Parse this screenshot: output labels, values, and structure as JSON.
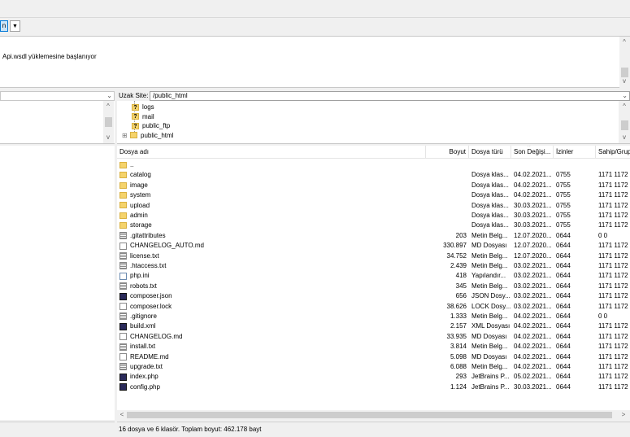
{
  "quickconnect": {
    "button_label": "n",
    "dropdown_icon": "chevron-down-icon"
  },
  "log": {
    "line": "Api.wsdl yüklemesine başlanıyor"
  },
  "remote": {
    "site_label": "Uzak Site:",
    "site_path": "/public_html",
    "tree": [
      {
        "label": "logs",
        "type": "unknown"
      },
      {
        "label": "mail",
        "type": "unknown"
      },
      {
        "label": "public_ftp",
        "type": "unknown"
      },
      {
        "label": "public_html",
        "type": "folder",
        "expand_symbol": "⊞"
      }
    ],
    "columns": {
      "name": "Dosya adı",
      "size": "Boyut",
      "type": "Dosya türü",
      "modified": "Son Değişi...",
      "perms": "İzinler",
      "owner": "Sahip/Grup"
    },
    "files": [
      {
        "icon": "folder",
        "name": "..",
        "size": "",
        "type": "",
        "modified": "",
        "perms": "",
        "owner": ""
      },
      {
        "icon": "folder",
        "name": "catalog",
        "size": "",
        "type": "Dosya klas...",
        "modified": "04.02.2021...",
        "perms": "0755",
        "owner": "1171 1172"
      },
      {
        "icon": "folder",
        "name": "image",
        "size": "",
        "type": "Dosya klas...",
        "modified": "04.02.2021...",
        "perms": "0755",
        "owner": "1171 1172"
      },
      {
        "icon": "folder",
        "name": "system",
        "size": "",
        "type": "Dosya klas...",
        "modified": "04.02.2021...",
        "perms": "0755",
        "owner": "1171 1172"
      },
      {
        "icon": "folder",
        "name": "upload",
        "size": "",
        "type": "Dosya klas...",
        "modified": "30.03.2021...",
        "perms": "0755",
        "owner": "1171 1172"
      },
      {
        "icon": "folder",
        "name": "admin",
        "size": "",
        "type": "Dosya klas...",
        "modified": "30.03.2021...",
        "perms": "0755",
        "owner": "1171 1172"
      },
      {
        "icon": "folder",
        "name": "storage",
        "size": "",
        "type": "Dosya klas...",
        "modified": "30.03.2021...",
        "perms": "0755",
        "owner": "1171 1172"
      },
      {
        "icon": "txt",
        "name": ".gitattributes",
        "size": "203",
        "type": "Metin Belg...",
        "modified": "12.07.2020...",
        "perms": "0644",
        "owner": "0 0"
      },
      {
        "icon": "file",
        "name": "CHANGELOG_AUTO.md",
        "size": "330.897",
        "type": "MD Dosyası",
        "modified": "12.07.2020...",
        "perms": "0644",
        "owner": "1171 1172"
      },
      {
        "icon": "txt",
        "name": "license.txt",
        "size": "34.752",
        "type": "Metin Belg...",
        "modified": "12.07.2020...",
        "perms": "0644",
        "owner": "1171 1172"
      },
      {
        "icon": "txt",
        "name": ".htaccess.txt",
        "size": "2.439",
        "type": "Metin Belg...",
        "modified": "03.02.2021...",
        "perms": "0644",
        "owner": "1171 1172"
      },
      {
        "icon": "ini",
        "name": "php.ini",
        "size": "418",
        "type": "Yapılandır...",
        "modified": "03.02.2021...",
        "perms": "0644",
        "owner": "1171 1172"
      },
      {
        "icon": "txt",
        "name": "robots.txt",
        "size": "345",
        "type": "Metin Belg...",
        "modified": "03.02.2021...",
        "perms": "0644",
        "owner": "1171 1172"
      },
      {
        "icon": "app",
        "name": "composer.json",
        "size": "656",
        "type": "JSON Dosy...",
        "modified": "03.02.2021...",
        "perms": "0644",
        "owner": "1171 1172"
      },
      {
        "icon": "file",
        "name": "composer.lock",
        "size": "38.626",
        "type": "LOCK Dosy...",
        "modified": "03.02.2021...",
        "perms": "0644",
        "owner": "1171 1172"
      },
      {
        "icon": "txt",
        "name": ".gitignore",
        "size": "1.333",
        "type": "Metin Belg...",
        "modified": "04.02.2021...",
        "perms": "0644",
        "owner": "0 0"
      },
      {
        "icon": "app",
        "name": "build.xml",
        "size": "2.157",
        "type": "XML Dosyası",
        "modified": "04.02.2021...",
        "perms": "0644",
        "owner": "1171 1172"
      },
      {
        "icon": "file",
        "name": "CHANGELOG.md",
        "size": "33.935",
        "type": "MD Dosyası",
        "modified": "04.02.2021...",
        "perms": "0644",
        "owner": "1171 1172"
      },
      {
        "icon": "txt",
        "name": "install.txt",
        "size": "3.814",
        "type": "Metin Belg...",
        "modified": "04.02.2021...",
        "perms": "0644",
        "owner": "1171 1172"
      },
      {
        "icon": "file",
        "name": "README.md",
        "size": "5.098",
        "type": "MD Dosyası",
        "modified": "04.02.2021...",
        "perms": "0644",
        "owner": "1171 1172"
      },
      {
        "icon": "txt",
        "name": "upgrade.txt",
        "size": "6.088",
        "type": "Metin Belg...",
        "modified": "04.02.2021...",
        "perms": "0644",
        "owner": "1171 1172"
      },
      {
        "icon": "app",
        "name": "index.php",
        "size": "293",
        "type": "JetBrains P...",
        "modified": "05.02.2021...",
        "perms": "0644",
        "owner": "1171 1172"
      },
      {
        "icon": "app",
        "name": "config.php",
        "size": "1.124",
        "type": "JetBrains P...",
        "modified": "30.03.2021...",
        "perms": "0644",
        "owner": "1171 1172"
      }
    ],
    "status": "16 dosya ve 6 klasör. Toplam boyut: 462.178 bayt"
  }
}
